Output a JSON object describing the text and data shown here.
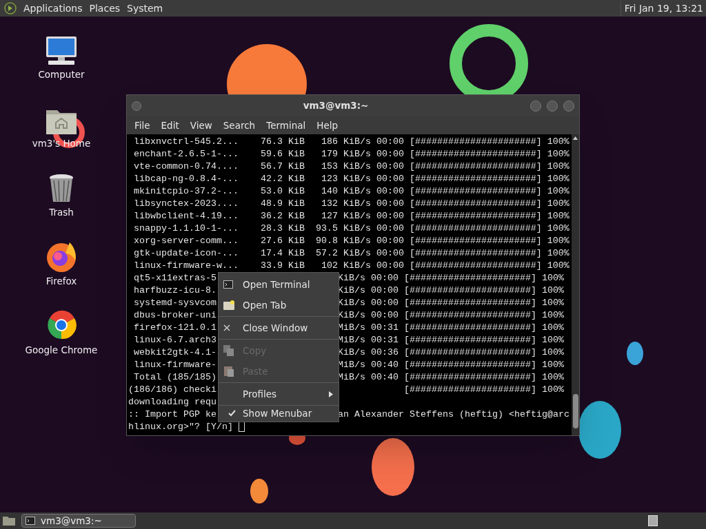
{
  "top_panel": {
    "menus": [
      "Applications",
      "Places",
      "System"
    ],
    "clock": "Fri Jan 19, 13:21"
  },
  "desktop_icons": [
    {
      "kind": "computer",
      "label": "Computer"
    },
    {
      "kind": "home",
      "label": "vm3's Home"
    },
    {
      "kind": "trash",
      "label": "Trash"
    },
    {
      "kind": "firefox",
      "label": "Firefox"
    },
    {
      "kind": "chrome",
      "label": "Google Chrome"
    }
  ],
  "window": {
    "title": "vm3@vm3:~",
    "menubar": [
      "File",
      "Edit",
      "View",
      "Search",
      "Terminal",
      "Help"
    ],
    "lines": [
      {
        "text": " libxnvctrl-545.2...    76.3 KiB   186 KiB/s 00:00 [######################] 100%"
      },
      {
        "text": " enchant-2.6.5-1-...    59.6 KiB   179 KiB/s 00:00 [######################] 100%"
      },
      {
        "text": " vte-common-0.74....    56.7 KiB   153 KiB/s 00:00 [######################] 100%"
      },
      {
        "text": " libcap-ng-0.8.4-...    42.2 KiB   123 KiB/s 00:00 [######################] 100%"
      },
      {
        "text": " mkinitcpio-37.2-...    53.0 KiB   140 KiB/s 00:00 [######################] 100%"
      },
      {
        "text": " libsynctex-2023....    48.9 KiB   132 KiB/s 00:00 [######################] 100%"
      },
      {
        "text": " libwbclient-4.19...    36.2 KiB   127 KiB/s 00:00 [######################] 100%"
      },
      {
        "text": " snappy-1.1.10-1-...    28.3 KiB  93.5 KiB/s 00:00 [######################] 100%"
      },
      {
        "text": " xorg-server-comm...    27.6 KiB  90.8 KiB/s 00:00 [######################] 100%"
      },
      {
        "text": " gtk-update-icon-...    17.4 KiB  57.2 KiB/s 00:00 [######################] 100%"
      },
      {
        "text": " linux-firmware-w...    33.9 KiB   102 KiB/s 00:00 [######################] 100%"
      },
      {
        "left": " qt5-x11extras-5",
        "right": "KiB/s 00:00 [######################] 100%"
      },
      {
        "left": " harfbuzz-icu-8.",
        "right": "KiB/s 00:00 [######################] 100%"
      },
      {
        "left": " systemd-sysvcom",
        "right": "KiB/s 00:00 [######################] 100%"
      },
      {
        "left": " dbus-broker-uni",
        "right": "KiB/s 00:00 [######################] 100%"
      },
      {
        "left": " firefox-121.0.1",
        "right": "MiB/s 00:31 [######################] 100%"
      },
      {
        "left": " linux-6.7.arch3",
        "right": "MiB/s 00:31 [######################] 100%"
      },
      {
        "left": " webkit2gtk-4.1-",
        "right": "KiB/s 00:36 [######################] 100%"
      },
      {
        "left": " linux-firmware-",
        "right": "MiB/s 00:40 [######################] 100%"
      },
      {
        "left": " Total (185/185)",
        "right": "MiB/s 00:40 [######################] 100%"
      },
      {
        "left": "(186/186) checki",
        "right": "            [######################] 100%"
      },
      {
        "left": "downloading requ"
      },
      {
        "left": ":: Import PGP ke",
        "right": "an Alexander Steffens (heftig) <heftig@arc"
      },
      {
        "text": "hlinux.org>\"? [Y/n] ",
        "cursor": true
      }
    ],
    "context_menu": [
      {
        "kind": "item",
        "label": "Open Terminal",
        "disabled": false
      },
      {
        "kind": "item",
        "label": "Open Tab",
        "disabled": false
      },
      {
        "kind": "separator"
      },
      {
        "kind": "item",
        "label": "Close Window",
        "disabled": false
      },
      {
        "kind": "separator"
      },
      {
        "kind": "item",
        "label": "Copy",
        "disabled": true
      },
      {
        "kind": "item",
        "label": "Paste",
        "disabled": true
      },
      {
        "kind": "separator"
      },
      {
        "kind": "submenu",
        "label": "Profiles"
      },
      {
        "kind": "separator"
      },
      {
        "kind": "check",
        "label": "Show Menubar",
        "checked": true
      }
    ]
  },
  "taskbar": {
    "tasks": [
      {
        "label": "vm3@vm3:~",
        "selected": true
      }
    ]
  }
}
